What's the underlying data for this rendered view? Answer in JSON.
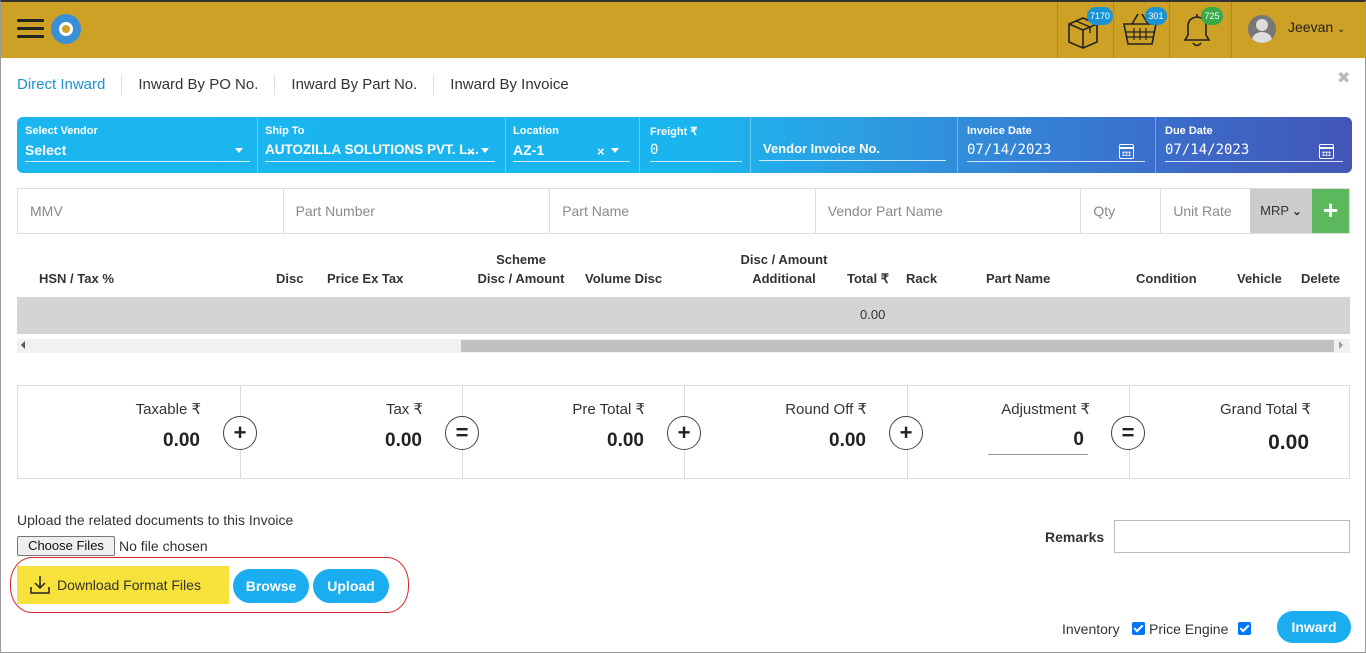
{
  "header": {
    "username": "Jeevan",
    "badges": {
      "box": "7170",
      "cart": "301",
      "bell": "725"
    },
    "colors": {
      "bar": "#cda126",
      "box_badge": "#1a93d4",
      "cart_badge": "#1a93d4",
      "bell_badge": "#3aa94a"
    }
  },
  "tabs": [
    "Direct Inward",
    "Inward By PO No.",
    "Inward By Part No.",
    "Inward By Invoice"
  ],
  "filters": {
    "vendor": {
      "label": "Select Vendor",
      "value": "Select"
    },
    "ship_to": {
      "label": "Ship To",
      "value": "AUTOZILLA SOLUTIONS PVT. L..."
    },
    "location": {
      "label": "Location",
      "value": "AZ-1"
    },
    "freight": {
      "label": "Freight ₹",
      "value": "0"
    },
    "vendor_invoice": {
      "label": "Vendor Invoice No.",
      "value": ""
    },
    "invoice_date": {
      "label": "Invoice Date",
      "value": "07/14/2023"
    },
    "due_date": {
      "label": "Due Date",
      "value": "07/14/2023"
    }
  },
  "part_row": {
    "mmv": "MMV",
    "part_number": "Part Number",
    "part_name": "Part Name",
    "vendor_part_name": "Vendor Part Name",
    "qty": "Qty",
    "unit_rate": "Unit Rate",
    "rate_type": "MRP",
    "add": "+"
  },
  "grid": {
    "headers": {
      "hsn": "HSN / Tax %",
      "disc": "Disc",
      "price_ex_tax": "Price Ex Tax",
      "scheme_1": "Scheme",
      "scheme_2": "Disc / Amount",
      "volume_disc": "Volume Disc",
      "additional_1": "Disc / Amount",
      "additional_2": "Additional",
      "total": "Total ₹",
      "rack": "Rack",
      "part_name": "Part Name",
      "condition": "Condition",
      "vehicle": "Vehicle",
      "delete": "Delete"
    },
    "total_value": "0.00"
  },
  "totals": {
    "taxable": {
      "label": "Taxable ₹",
      "value": "0.00"
    },
    "tax": {
      "label": "Tax ₹",
      "value": "0.00"
    },
    "pre_total": {
      "label": "Pre Total ₹",
      "value": "0.00"
    },
    "round_off": {
      "label": "Round Off ₹",
      "value": "0.00"
    },
    "adjustment": {
      "label": "Adjustment ₹",
      "value": "0"
    },
    "grand_total": {
      "label": "Grand Total ₹",
      "value": "0.00"
    },
    "ops": [
      "+",
      "=",
      "+",
      "+",
      "="
    ]
  },
  "upload": {
    "text": "Upload the related documents to this Invoice",
    "choose": "Choose Files",
    "no_file": "No file chosen",
    "download": "Download Format Files",
    "browse": "Browse",
    "upload": "Upload"
  },
  "remarks": {
    "label": "Remarks",
    "value": ""
  },
  "footer": {
    "inventory": "Inventory",
    "price_engine": "Price Engine",
    "inward": "Inward"
  }
}
